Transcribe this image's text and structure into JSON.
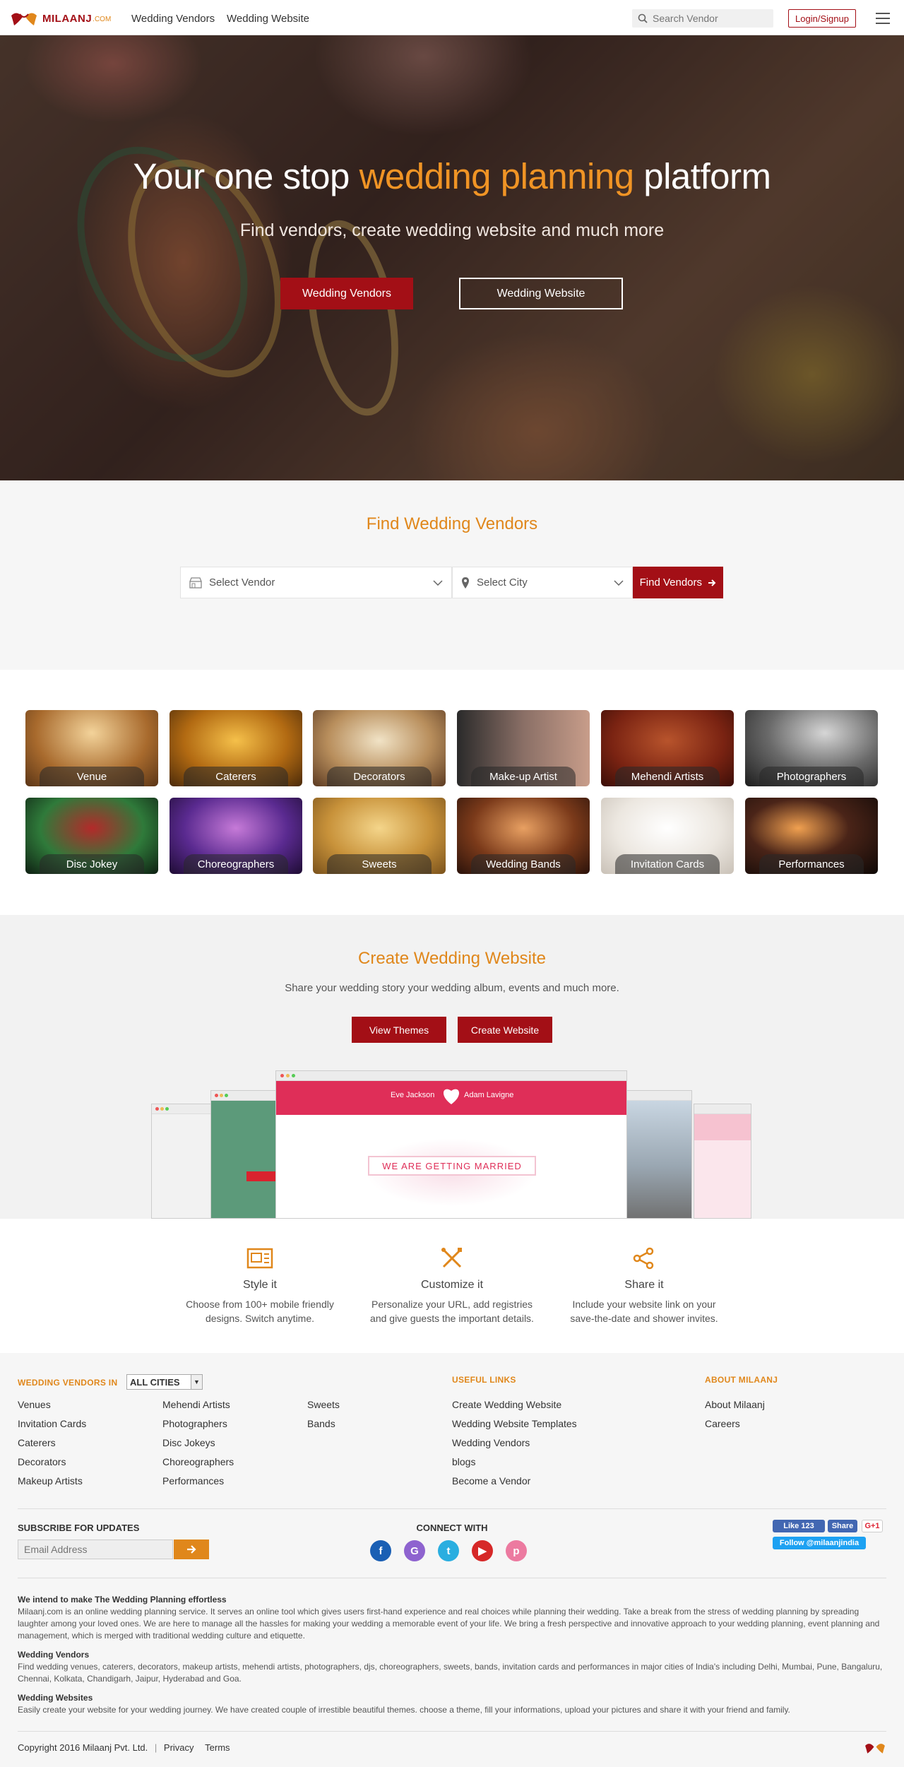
{
  "header": {
    "brand": "MILAANJ",
    "brand_suffix": ".COM",
    "nav": [
      "Wedding Vendors",
      "Wedding Website"
    ],
    "search_placeholder": "Search Vendor",
    "login_label": "Login/Signup"
  },
  "hero": {
    "title_pre": "Your one stop",
    "title_accent": "wedding planning",
    "title_post": "platform",
    "subtitle": "Find vendors, create wedding website and much more",
    "btn_vendors": "Wedding Vendors",
    "btn_website": "Wedding Website"
  },
  "find": {
    "title": "Find Wedding Vendors",
    "vendor_select": "Select Vendor",
    "city_select": "Select City",
    "button": "Find Vendors"
  },
  "categories": [
    {
      "label": "Venue"
    },
    {
      "label": "Caterers"
    },
    {
      "label": "Decorators"
    },
    {
      "label": "Make-up Artist"
    },
    {
      "label": "Mehendi Artists"
    },
    {
      "label": "Photographers"
    },
    {
      "label": "Disc Jokey"
    },
    {
      "label": "Choreographers"
    },
    {
      "label": "Sweets"
    },
    {
      "label": "Wedding Bands"
    },
    {
      "label": "Invitation Cards"
    },
    {
      "label": "Performances"
    }
  ],
  "create": {
    "title": "Create Wedding Website",
    "subtitle": "Share your wedding story your wedding album, events and much more.",
    "btn_themes": "View Themes",
    "btn_create": "Create Website",
    "mock_names_left": "Eve Jackson",
    "mock_names_right": "Adam Lavigne",
    "mock_banner": "WE ARE GETTING MARRIED"
  },
  "features": [
    {
      "title": "Style it",
      "desc1": "Choose from 100+ mobile friendly",
      "desc2": "designs. Switch anytime.",
      "icon": "layout-icon"
    },
    {
      "title": "Customize it",
      "desc1": "Personalize your URL, add registries",
      "desc2": "and give guests the important details.",
      "icon": "tools-icon"
    },
    {
      "title": "Share it",
      "desc1": "Include your website link on your",
      "desc2": "save-the-date and shower invites.",
      "icon": "share-icon"
    }
  ],
  "footer": {
    "vendors_in_label": "WEDDING VENDORS IN",
    "city_value": "ALL CITIES",
    "vendor_col1": [
      "Venues",
      "Invitation Cards",
      "Caterers",
      "Decorators",
      "Makeup Artists"
    ],
    "vendor_col2": [
      "Mehendi Artists",
      "Photographers",
      "Disc Jokeys",
      "Choreographers",
      "Performances"
    ],
    "vendor_col3": [
      "Sweets",
      "Bands"
    ],
    "useful_title": "USEFUL LINKS",
    "useful_links": [
      "Create Wedding Website",
      "Wedding Website Templates",
      "Wedding Vendors",
      "blogs",
      "Become a Vendor"
    ],
    "about_title": "ABOUT MILAANJ",
    "about_links": [
      "About Milaanj",
      "Careers"
    ],
    "subscribe_title": "SUBSCRIBE FOR UPDATES",
    "email_placeholder": "Email Address",
    "connect_title": "CONNECT WITH",
    "fb_like": "Like 123",
    "fb_share": "Share",
    "gplus": "G+1",
    "twitter_follow": "Follow @milaanjindia",
    "about_h1": "We intend to make The Wedding Planning effortless",
    "about_p1": "Milaanj.com is an online wedding planning service. It serves an online tool which gives users first-hand experience and real choices while planning their wedding. Take a break from the stress of wedding planning by spreading laughter among your loved ones. We are here to manage all the hassles for making your wedding a memorable event of your life. We bring a fresh perspective and innovative approach to your wedding planning, event planning and management, which is merged with traditional wedding culture and etiquette.",
    "about_h2": "Wedding Vendors",
    "about_p2": "Find wedding venues, caterers, decorators, makeup artists, mehendi artists, photographers, djs, choreographers, sweets, bands, invitation cards and performances in major cities of India's including Delhi, Mumbai, Pune, Bangaluru, Chennai, Kolkata, Chandigarh, Jaipur, Hyderabad and Goa.",
    "about_h3": "Wedding Websites",
    "about_p3": "Easily create your website for your wedding journey. We have created couple of irrestible beautiful themes. choose a theme, fill your informations, upload your pictures and share it with your friend and family.",
    "copyright": "Copyright 2016 Milaanj Pvt. Ltd.",
    "privacy": "Privacy",
    "terms": "Terms"
  },
  "colors": {
    "accent": "#e0871b",
    "brand": "#a30f16"
  }
}
